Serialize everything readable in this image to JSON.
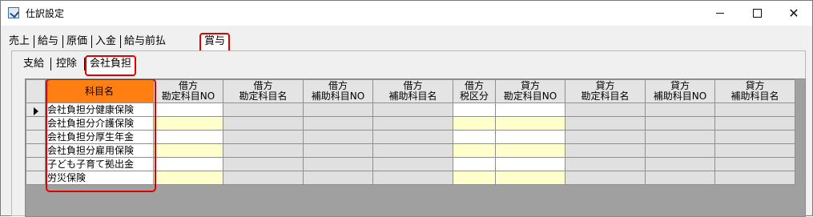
{
  "window": {
    "title": "仕訳設定",
    "controls": {
      "minimize": "—",
      "maximize": "☐",
      "close": "✕"
    }
  },
  "tabs_main": [
    {
      "label": "売上"
    },
    {
      "label": "給与"
    },
    {
      "label": "原価"
    },
    {
      "label": "入金"
    },
    {
      "label": "給与前払"
    },
    {
      "label": "賞与",
      "selected": true
    }
  ],
  "tabs_sub": [
    {
      "label": "支給"
    },
    {
      "label": "控除"
    },
    {
      "label": "会社負担",
      "selected": true
    }
  ],
  "grid": {
    "columns": [
      {
        "label": "科目名"
      },
      {
        "label": "借方\n勘定科目NO"
      },
      {
        "label": "借方\n勘定科目名"
      },
      {
        "label": "借方\n補助科目NO"
      },
      {
        "label": "借方\n補助科目名"
      },
      {
        "label": "借方\n税区分"
      },
      {
        "label": "貸方\n勘定科目NO"
      },
      {
        "label": "貸方\n勘定科目名"
      },
      {
        "label": "貸方\n補助科目NO"
      },
      {
        "label": "貸方\n補助科目名"
      }
    ],
    "rows": [
      {
        "name": "会社負担分健康保険",
        "current": true
      },
      {
        "name": "会社負担分介護保険"
      },
      {
        "name": "会社負担分厚生年金"
      },
      {
        "name": "会社負担分雇用保険"
      },
      {
        "name": "子ども子育て拠出金"
      },
      {
        "name": "労災保険"
      }
    ]
  },
  "colors": {
    "highlight_header": "#ff7f12",
    "annotation": "#e00000",
    "editable_alt": "#ffffcc"
  }
}
